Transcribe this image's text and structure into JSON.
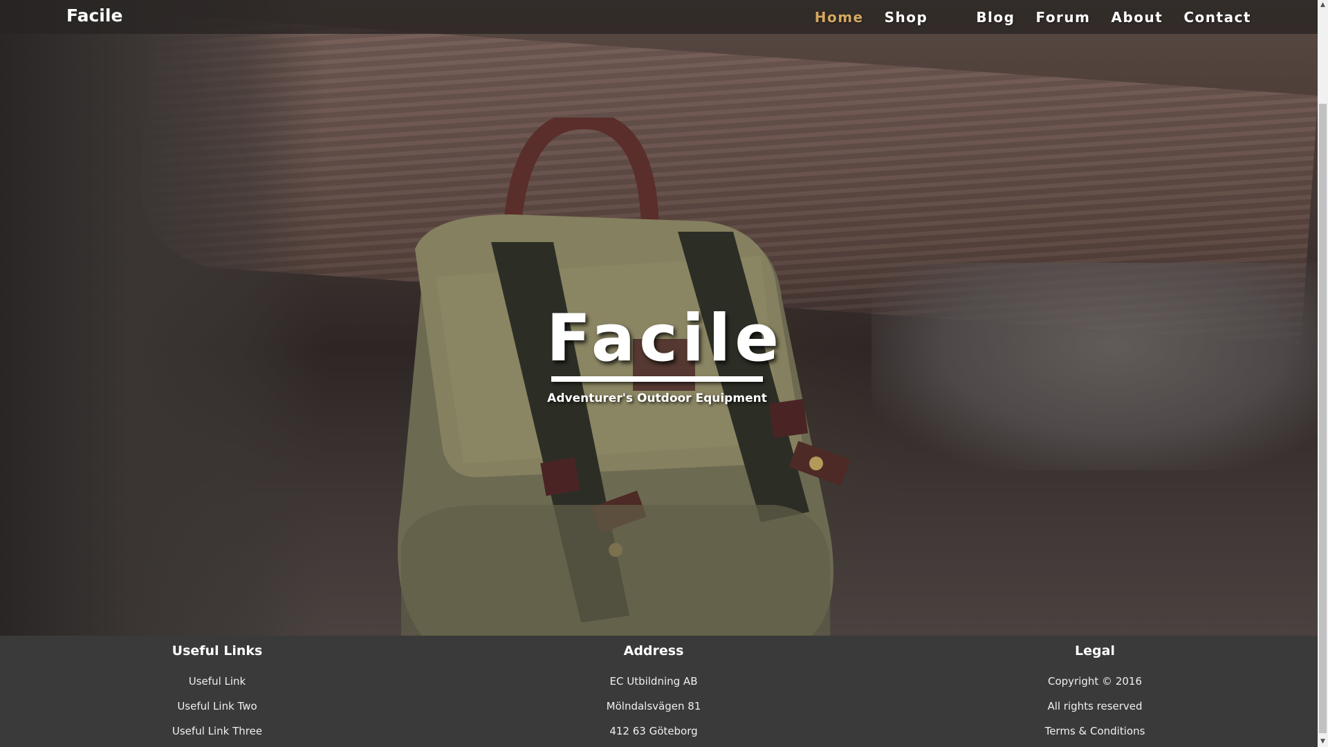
{
  "brand": {
    "name": "Facile"
  },
  "nav": {
    "items": [
      {
        "label": "Home",
        "active": true
      },
      {
        "label": "Shop",
        "active": false
      },
      {
        "label": "Blog",
        "active": false
      },
      {
        "label": "Forum",
        "active": false
      },
      {
        "label": "About",
        "active": false
      },
      {
        "label": "Contact",
        "active": false
      }
    ],
    "active_color": "#d4a860"
  },
  "hero": {
    "title": "Facile",
    "subtitle": "Adventurer's Outdoor Equipment",
    "image": "backpack-on-forest-floor"
  },
  "footer": {
    "background": "#3a3a3a",
    "columns": [
      {
        "heading": "Useful Links",
        "items": [
          "Useful Link",
          "Useful Link Two",
          "Useful Link Three"
        ]
      },
      {
        "heading": "Address",
        "items": [
          "EC Utbildning AB",
          "Mölndalsvägen 81",
          "412 63 Göteborg"
        ]
      },
      {
        "heading": "Legal",
        "items": [
          "Copyright © 2016",
          "All rights reserved",
          "Terms & Conditions"
        ]
      }
    ]
  }
}
